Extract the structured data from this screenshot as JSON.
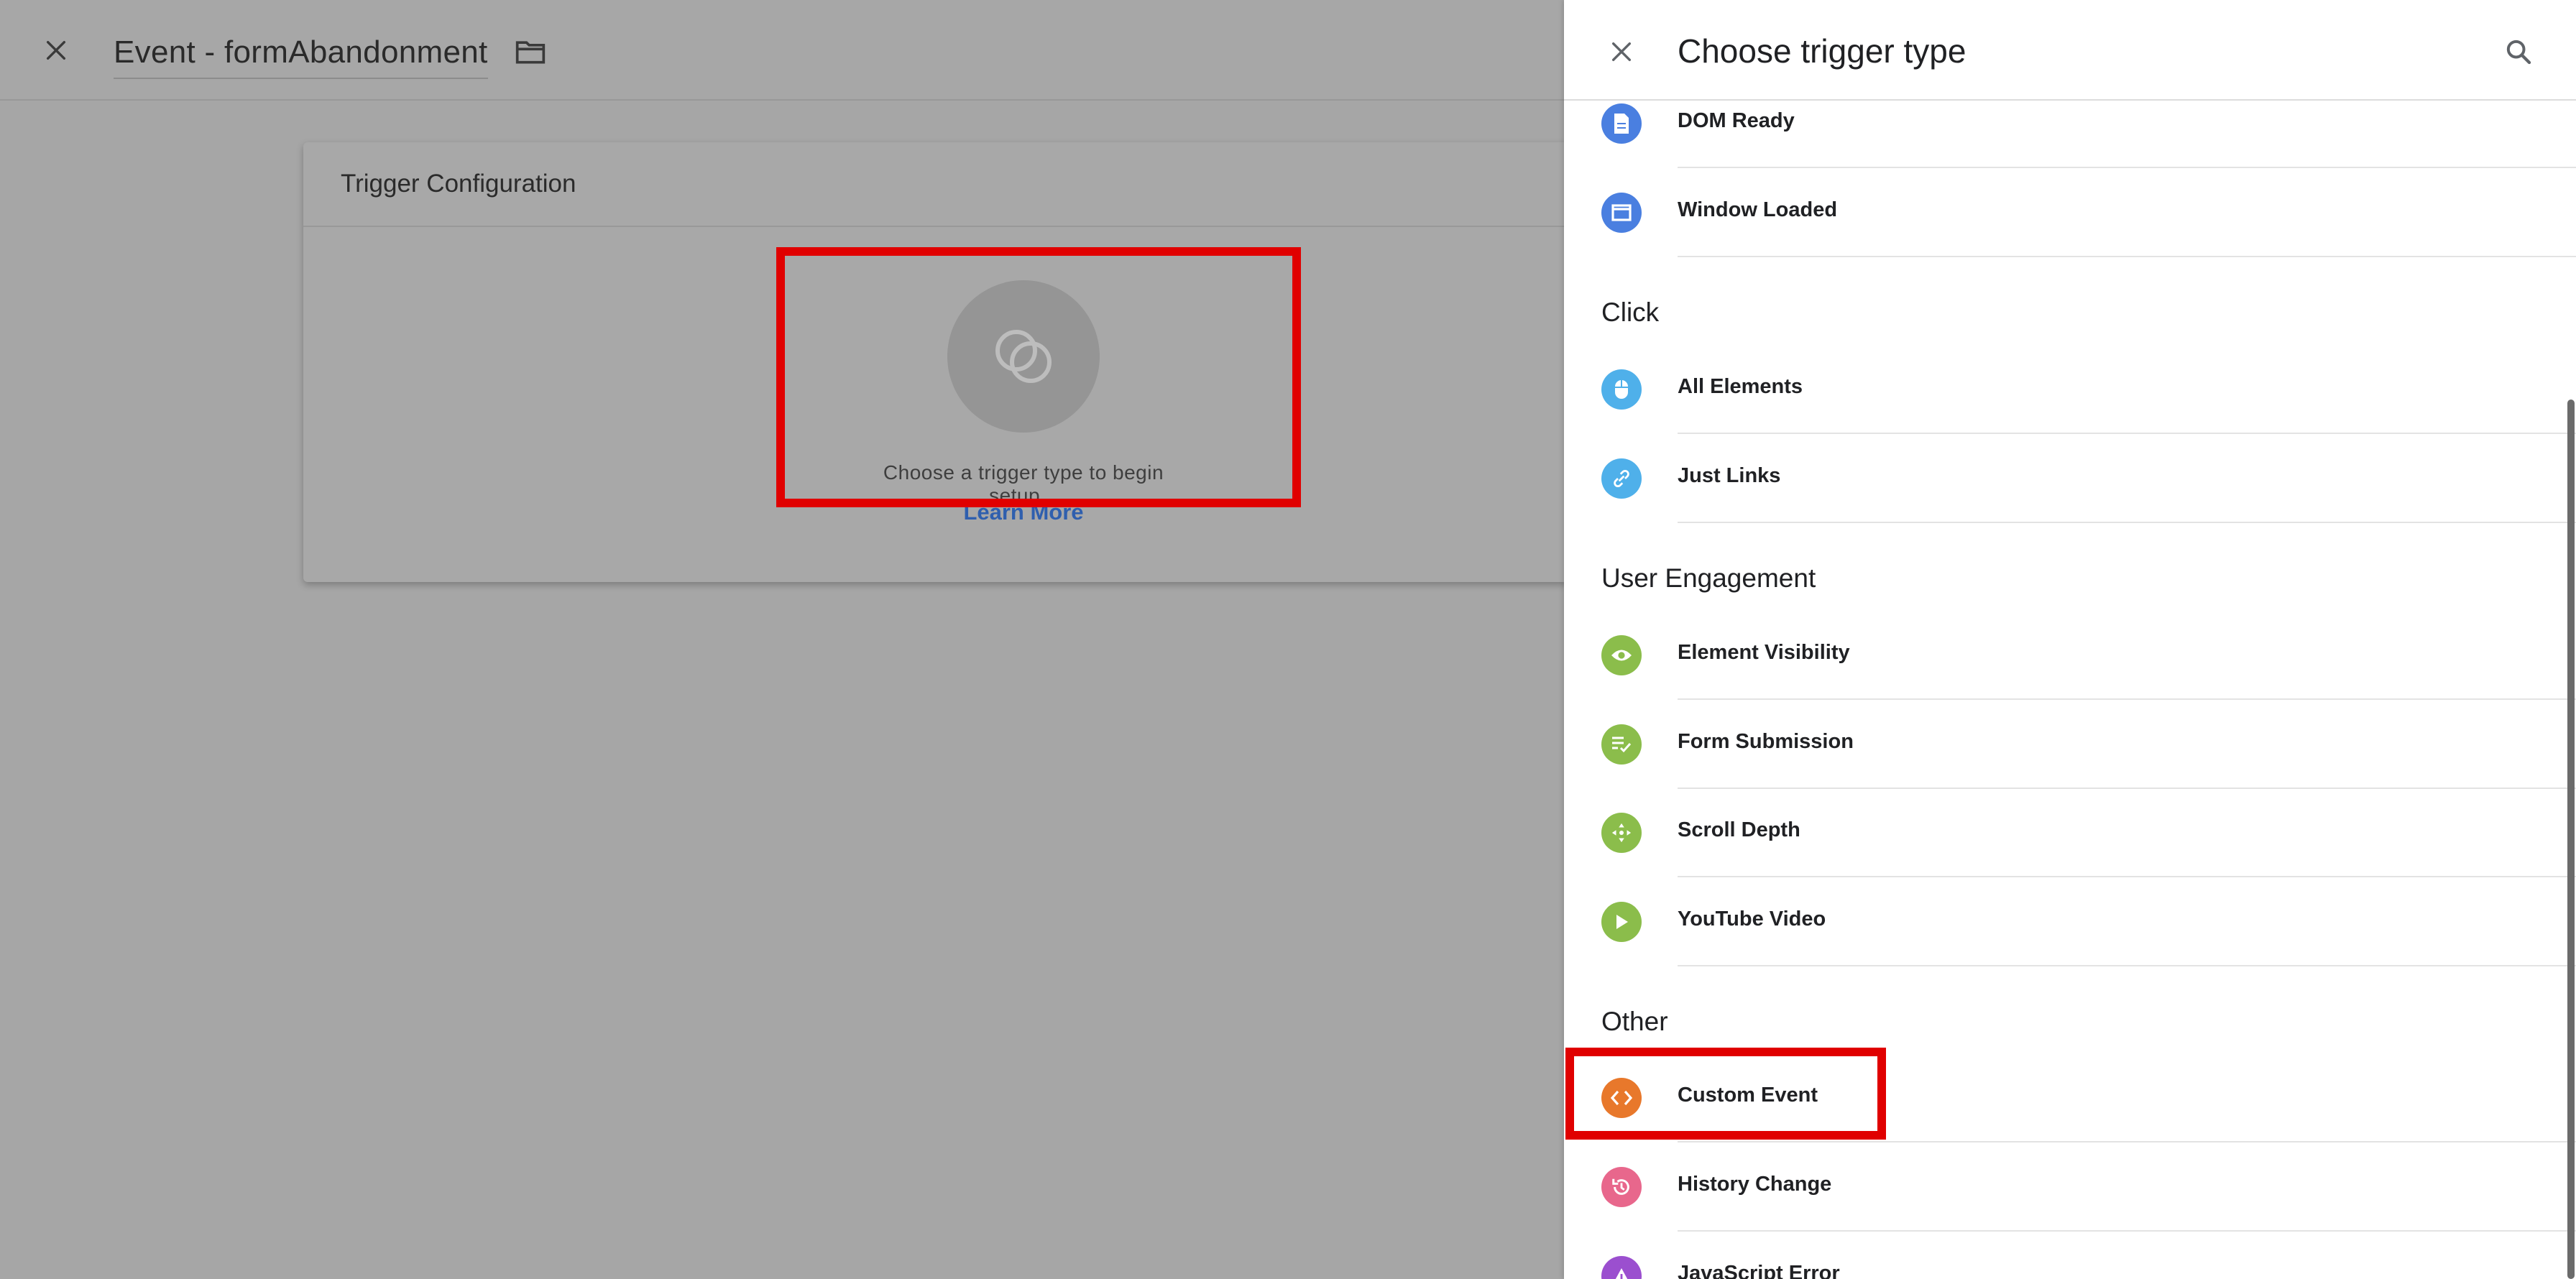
{
  "editor": {
    "title": "Event - formAbandonment",
    "card_title": "Trigger Configuration",
    "placeholder_text": "Choose a trigger type to begin setup...",
    "learn_more": "Learn More"
  },
  "panel": {
    "title": "Choose trigger type",
    "groups": {
      "page_items": [
        {
          "label": "DOM Ready",
          "icon": "document-icon",
          "color": "#4a7fe0"
        },
        {
          "label": "Window Loaded",
          "icon": "window-icon",
          "color": "#4a7fe0"
        }
      ],
      "click": {
        "heading": "Click",
        "items": [
          {
            "label": "All Elements",
            "icon": "mouse-icon",
            "color": "#4fb0ea"
          },
          {
            "label": "Just Links",
            "icon": "link-icon",
            "color": "#4fb0ea"
          }
        ]
      },
      "user_engagement": {
        "heading": "User Engagement",
        "items": [
          {
            "label": "Element Visibility",
            "icon": "eye-icon",
            "color": "#8bbd4b"
          },
          {
            "label": "Form Submission",
            "icon": "form-check-icon",
            "color": "#8bbd4b"
          },
          {
            "label": "Scroll Depth",
            "icon": "move-arrows-icon",
            "color": "#8bbd4b"
          },
          {
            "label": "YouTube Video",
            "icon": "play-icon",
            "color": "#8bbd4b"
          }
        ]
      },
      "other": {
        "heading": "Other",
        "items": [
          {
            "label": "Custom Event",
            "icon": "code-brackets-icon",
            "color": "#e8782b"
          },
          {
            "label": "History Change",
            "icon": "history-icon",
            "color": "#e8678c"
          },
          {
            "label": "JavaScript Error",
            "icon": "warning-triangle-icon",
            "color": "#9b4fcf"
          }
        ]
      }
    }
  }
}
